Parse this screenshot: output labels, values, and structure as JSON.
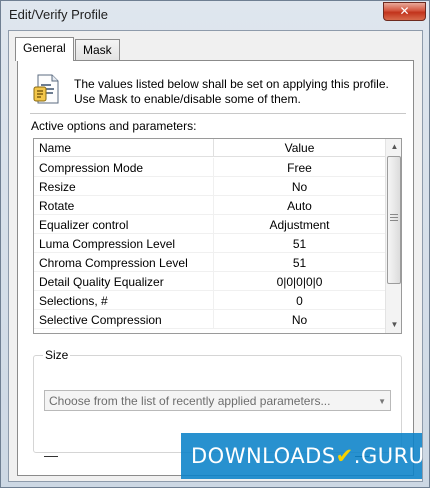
{
  "window": {
    "title": "Edit/Verify Profile",
    "close_glyph": "✕"
  },
  "tabs": [
    {
      "label": "General",
      "active": true
    },
    {
      "label": "Mask",
      "active": false
    }
  ],
  "info": {
    "line1": "The values listed below shall be set on applying this profile.",
    "line2": "Use Mask to enable/disable some of them.",
    "icon": "document-info-icon"
  },
  "options": {
    "section_label": "Active options and parameters:",
    "columns": [
      "Name",
      "Value"
    ],
    "rows": [
      {
        "name": "Compression Mode",
        "value": "Free"
      },
      {
        "name": "Resize",
        "value": "No"
      },
      {
        "name": "Rotate",
        "value": "Auto"
      },
      {
        "name": "Equalizer control",
        "value": "Adjustment"
      },
      {
        "name": "Luma Compression Level",
        "value": "51"
      },
      {
        "name": "Chroma Compression Level",
        "value": "51"
      },
      {
        "name": "Detail Quality Equalizer",
        "value": "0|0|0|0|0"
      },
      {
        "name": "Selections, #",
        "value": "0"
      },
      {
        "name": "Selective Compression",
        "value": "No"
      }
    ]
  },
  "size": {
    "legend": "Size",
    "combo_placeholder": "Choose from the list of recently applied parameters..."
  },
  "watermark": {
    "text": "DOWNLOADS",
    "mark": "✔",
    "suffix": ".GURU"
  },
  "colors": {
    "watermark_bg": "#0a82c8",
    "close_button": "#c2331c"
  }
}
